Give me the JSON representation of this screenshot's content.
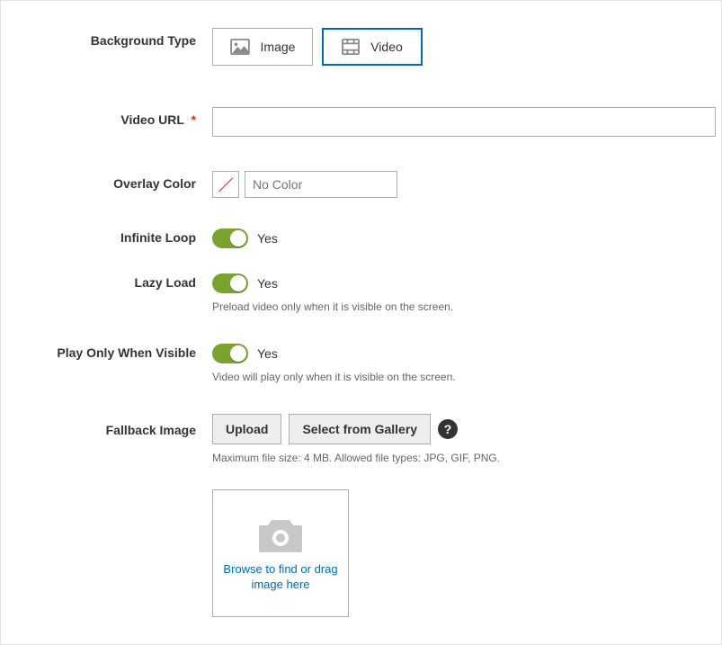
{
  "backgroundType": {
    "label": "Background Type",
    "options": {
      "image": "Image",
      "video": "Video"
    },
    "selected": "video"
  },
  "videoUrl": {
    "label": "Video URL",
    "value": ""
  },
  "overlayColor": {
    "label": "Overlay Color",
    "placeholder": "No Color"
  },
  "infiniteLoop": {
    "label": "Infinite Loop",
    "valueText": "Yes"
  },
  "lazyLoad": {
    "label": "Lazy Load",
    "valueText": "Yes",
    "helper": "Preload video only when it is visible on the screen."
  },
  "playOnlyVisible": {
    "label": "Play Only When Visible",
    "valueText": "Yes",
    "helper": "Video will play only when it is visible on the screen."
  },
  "fallbackImage": {
    "label": "Fallback Image",
    "uploadLabel": "Upload",
    "galleryLabel": "Select from Gallery",
    "helper": "Maximum file size: 4 MB. Allowed file types: JPG, GIF, PNG.",
    "dropText": "Browse to find or drag image here"
  },
  "requiredMark": "*",
  "helpMark": "?"
}
